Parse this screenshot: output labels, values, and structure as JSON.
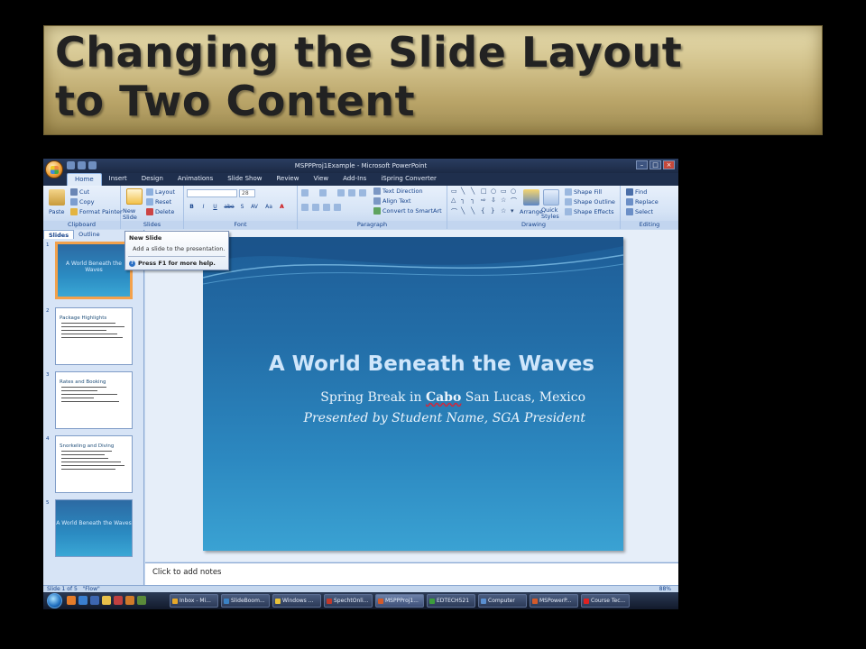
{
  "slide_title": {
    "line1": "Changing the Slide Layout",
    "line2": "to Two Content"
  },
  "app": {
    "window_title": "MSPPProj1Example - Microsoft PowerPoint",
    "tabs": [
      "Home",
      "Insert",
      "Design",
      "Animations",
      "Slide Show",
      "Review",
      "View",
      "Add-Ins",
      "iSpring Converter"
    ],
    "active_tab": "Home"
  },
  "ribbon": {
    "clipboard": {
      "label": "Clipboard",
      "paste": "Paste",
      "cut": "Cut",
      "copy": "Copy",
      "format_painter": "Format Painter"
    },
    "slides": {
      "label": "Slides",
      "new_slide": "New Slide",
      "layout": "Layout",
      "reset": "Reset",
      "delete": "Delete"
    },
    "font": {
      "label": "Font",
      "size": "28",
      "bold": "B",
      "italic": "I",
      "underline": "U",
      "strike": "abe",
      "shadow": "S",
      "spacing": "AV",
      "case": "Aa",
      "color": "A"
    },
    "paragraph": {
      "label": "Paragraph",
      "text_direction": "Text Direction",
      "align_text": "Align Text",
      "convert_smartart": "Convert to SmartArt"
    },
    "drawing": {
      "label": "Drawing",
      "arrange": "Arrange",
      "quick_styles": "Quick Styles",
      "shape_fill": "Shape Fill",
      "shape_outline": "Shape Outline",
      "shape_effects": "Shape Effects"
    },
    "editing": {
      "label": "Editing",
      "find": "Find",
      "replace": "Replace",
      "select": "Select"
    }
  },
  "tooltip": {
    "title": "New Slide",
    "description": "Add a slide to the presentation.",
    "help": "Press F1 for more help."
  },
  "left_pane": {
    "tabs": [
      "Slides",
      "Outline"
    ],
    "thumbnails": [
      {
        "num": "1",
        "title": "A World Beneath the Waves"
      },
      {
        "num": "2",
        "title": "Package Highlights"
      },
      {
        "num": "3",
        "title": "Rates and Booking"
      },
      {
        "num": "4",
        "title": "Snorkeling and Diving"
      },
      {
        "num": "5",
        "title": "A World Beneath the Waves"
      }
    ]
  },
  "slide": {
    "title": "A World Beneath the Waves",
    "subtitle_a": "Spring Break in ",
    "subtitle_b": "Cabo",
    "subtitle_c": " San Lucas, Mexico",
    "subtitle2": "Presented by Student Name, SGA President"
  },
  "notes": {
    "placeholder": "Click to add notes"
  },
  "status": {
    "slide_of": "Slide 1 of 5",
    "theme": "\"Flow\"",
    "zoom": "88%"
  },
  "taskbar": {
    "items": [
      "Inbox - Mi...",
      "SlideBoom...",
      "Windows ...",
      "SpechtOnli...",
      "MSPPProj1...",
      "EDTECH521",
      "Computer",
      "MSPowerP...",
      "Course Tec..."
    ],
    "colors": [
      "#e4a72a",
      "#3b82c4",
      "#e7c23a",
      "#c0392b",
      "#d35a2a",
      "#3c9d3c",
      "#5a8fd0",
      "#d35a2a",
      "#d22"
    ]
  }
}
